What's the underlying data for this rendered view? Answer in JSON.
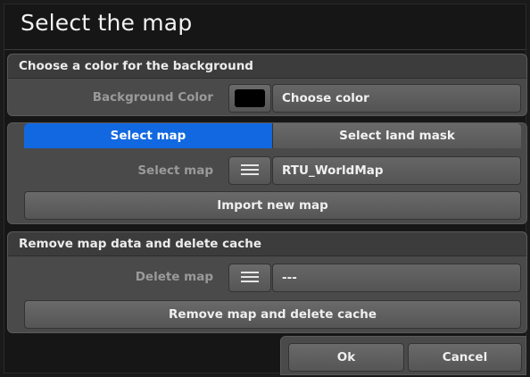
{
  "window": {
    "title": "Select the map"
  },
  "background_panel": {
    "heading": "Choose a color for the background",
    "label": "Background Color",
    "swatch_color": "#000000",
    "button": "Choose color"
  },
  "map_panel": {
    "tabs": [
      {
        "label": "Select map",
        "active": true
      },
      {
        "label": "Select land mask",
        "active": false
      }
    ],
    "label": "Select map",
    "value": "RTU_WorldMap",
    "import_button": "Import new map"
  },
  "remove_panel": {
    "heading": "Remove map data and delete cache",
    "label": "Delete map",
    "value": "---",
    "remove_button": "Remove map and delete cache"
  },
  "footer": {
    "ok": "Ok",
    "cancel": "Cancel"
  },
  "colors": {
    "accent": "#1268e0",
    "panel": "#4a4a4a",
    "background": "#161616"
  }
}
